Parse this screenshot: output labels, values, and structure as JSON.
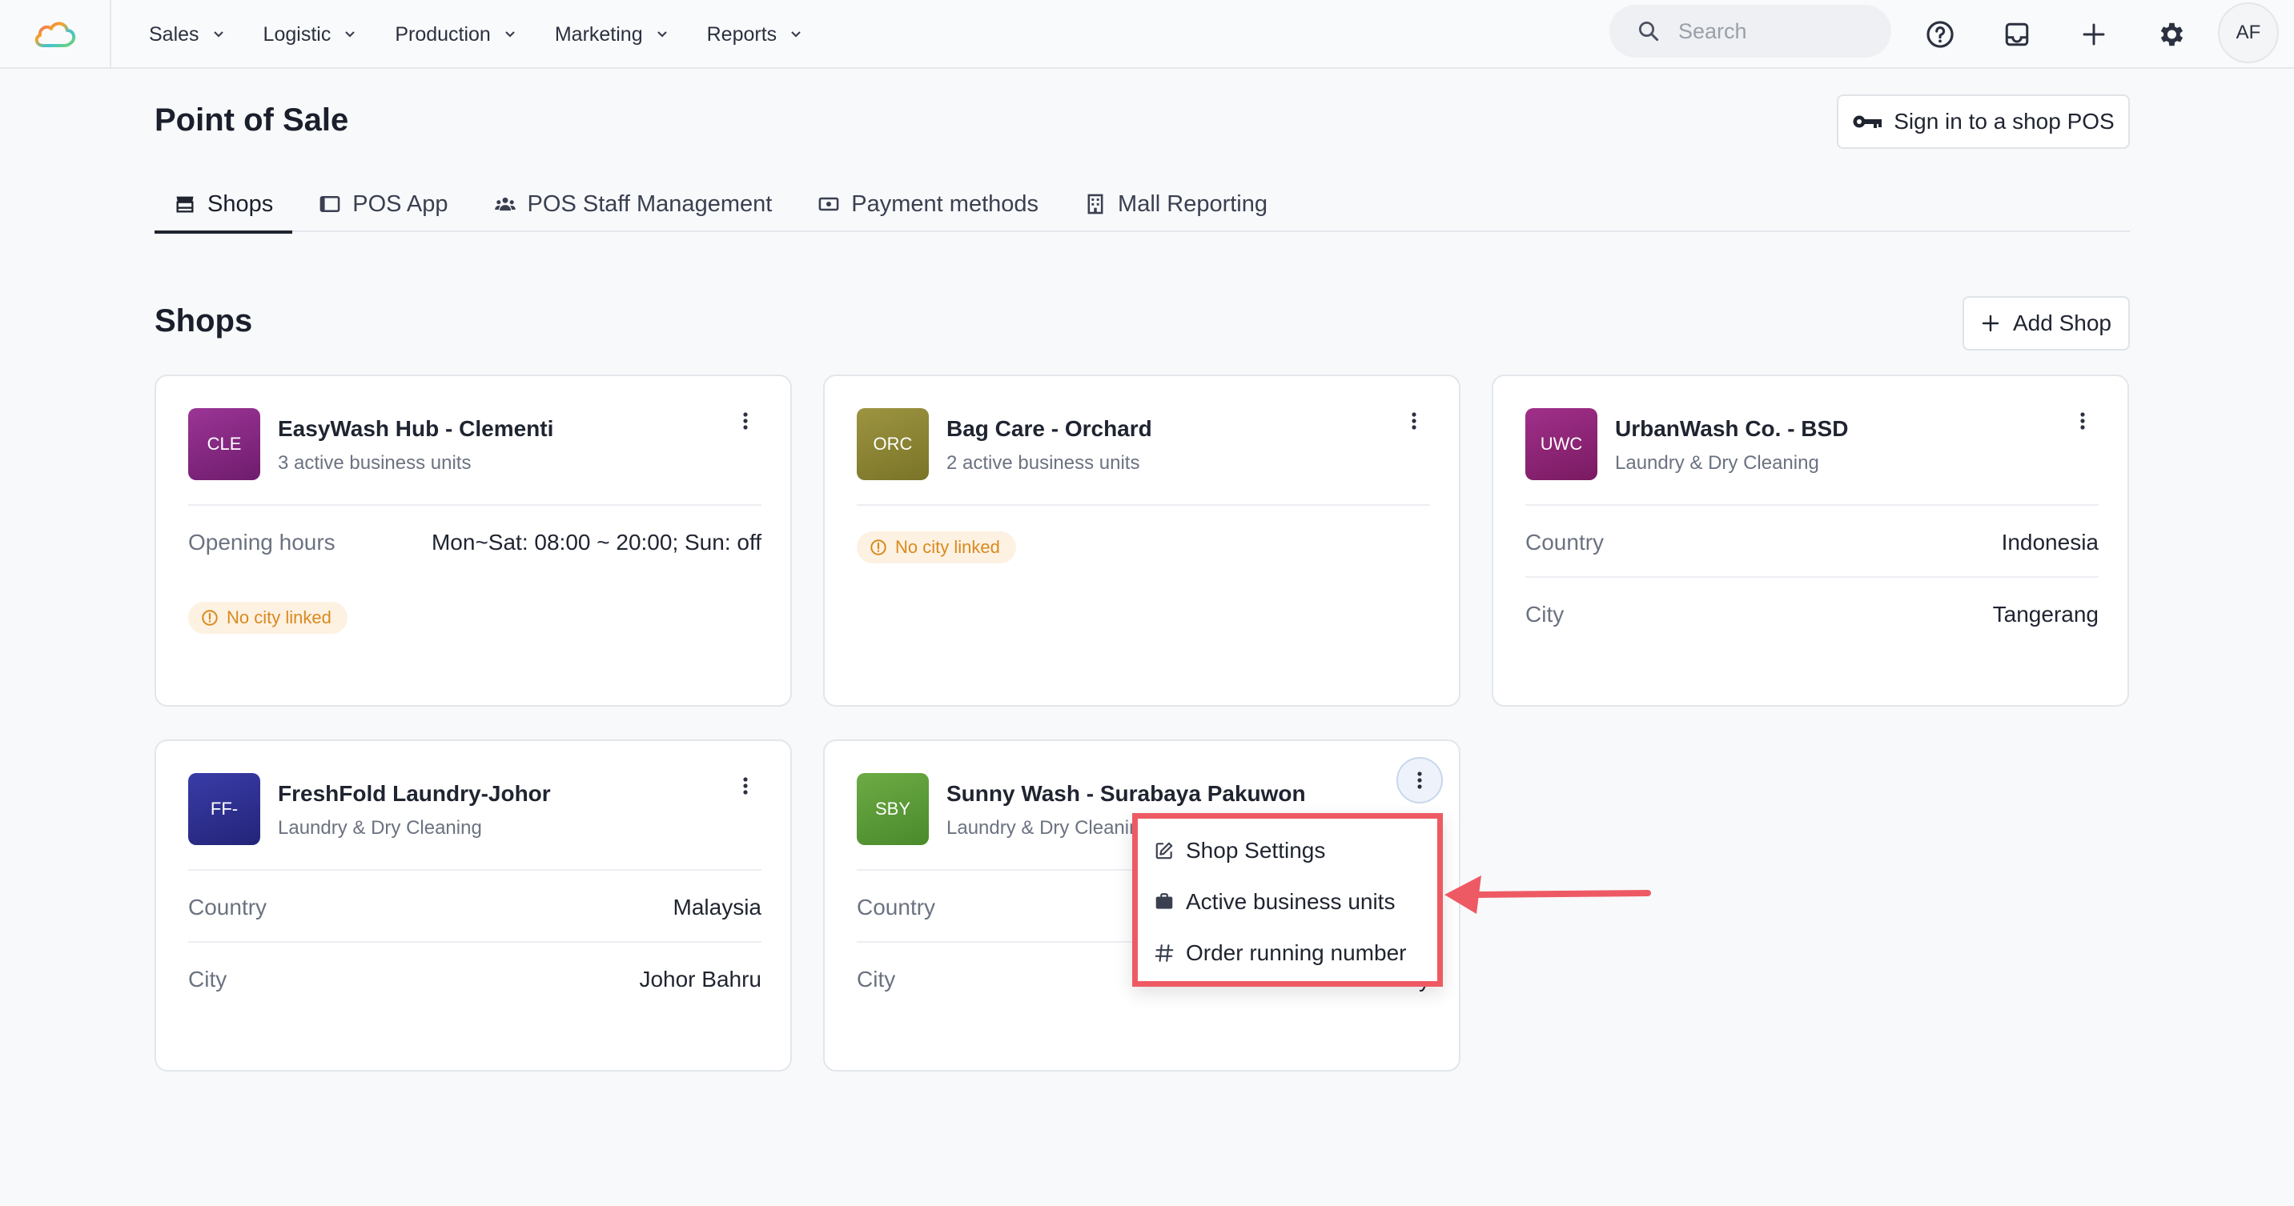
{
  "nav": {
    "items": [
      {
        "label": "Sales"
      },
      {
        "label": "Logistic"
      },
      {
        "label": "Production"
      },
      {
        "label": "Marketing"
      },
      {
        "label": "Reports"
      }
    ],
    "search_placeholder": "Search",
    "avatar_initials": "AF"
  },
  "page": {
    "title": "Point of Sale",
    "signin_label": "Sign in to a shop POS",
    "tabs": [
      {
        "label": "Shops",
        "icon": "store-icon",
        "active": true
      },
      {
        "label": "POS App",
        "icon": "tablet-icon"
      },
      {
        "label": "POS Staff Management",
        "icon": "people-icon"
      },
      {
        "label": "Payment methods",
        "icon": "cash-icon"
      },
      {
        "label": "Mall Reporting",
        "icon": "building-icon"
      }
    ],
    "section_title": "Shops",
    "add_shop_label": "Add Shop"
  },
  "shops": [
    {
      "initials": "CLE",
      "name": "EasyWash Hub - Clementi",
      "subtitle": "3 active business units",
      "color": "#8a2a86",
      "rows": [
        {
          "key": "Opening hours",
          "value": "Mon~Sat: 08:00 ~ 20:00; Sun: off"
        }
      ],
      "badge": "No city linked"
    },
    {
      "initials": "ORC",
      "name": "Bag Care - Orchard",
      "subtitle": "2 active business units",
      "color": "#8c8634",
      "rows": [],
      "badge": "No city linked"
    },
    {
      "initials": "UWC",
      "name": "UrbanWash Co. - BSD",
      "subtitle": "Laundry & Dry Cleaning",
      "color": "#8e2676",
      "rows": [
        {
          "key": "Country",
          "value": "Indonesia"
        },
        {
          "key": "City",
          "value": "Tangerang"
        }
      ]
    },
    {
      "initials": "FF-",
      "name": "FreshFold Laundry-Johor",
      "subtitle": "Laundry & Dry Cleaning",
      "color": "#2f3190",
      "rows": [
        {
          "key": "Country",
          "value": "Malaysia"
        },
        {
          "key": "City",
          "value": "Johor Bahru"
        }
      ]
    },
    {
      "initials": "SBY",
      "name": "Sunny Wash - Surabaya Pakuwon",
      "subtitle": "Laundry & Dry Cleanir",
      "color": "#5d9a3a",
      "rows": [
        {
          "key": "Country",
          "value": ""
        },
        {
          "key": "City",
          "value": "y"
        }
      ]
    }
  ],
  "menu": {
    "items": [
      {
        "label": "Shop Settings",
        "icon": "edit-icon"
      },
      {
        "label": "Active business units",
        "icon": "briefcase-icon"
      },
      {
        "label": "Order running number",
        "icon": "hash-icon"
      }
    ]
  },
  "colors": {
    "highlight": "#ee5a64",
    "badge_text": "#d98a1e",
    "badge_bg": "#fdf1e2"
  }
}
